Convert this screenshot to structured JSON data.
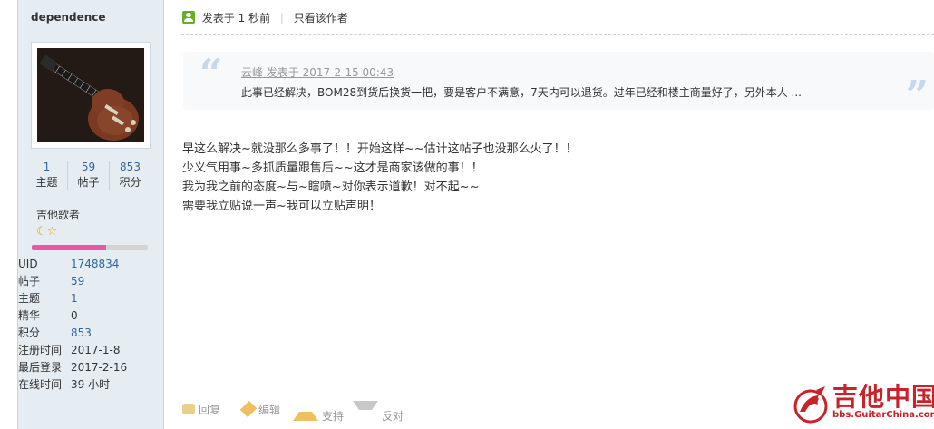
{
  "user": {
    "name": "dependence",
    "stats": [
      {
        "value": "1",
        "label": "主题"
      },
      {
        "value": "59",
        "label": "帖子"
      },
      {
        "value": "853",
        "label": "积分"
      }
    ],
    "group": "吉他歌者",
    "rank_icons": [
      "moon-icon",
      "star-icon"
    ],
    "level_progress": 0.64,
    "level_bar_color": "#e75aa3",
    "info": [
      {
        "key": "UID",
        "value": "1748834"
      },
      {
        "key": "帖子",
        "value": "59"
      },
      {
        "key": "主题",
        "value": "1"
      },
      {
        "key": "精华",
        "value": "0"
      },
      {
        "key": "积分",
        "value": "853"
      },
      {
        "key": "注册时间",
        "value": "2017-1-8"
      },
      {
        "key": "最后登录",
        "value": "2017-2-16"
      },
      {
        "key": "在线时间",
        "value": "39 小时"
      }
    ]
  },
  "post": {
    "posted": "发表于 1 秒前",
    "only_author": "只看该作者",
    "quote": {
      "author_line": "云峰 发表于 2017-2-15 00:43",
      "text": "此事已经解决，BOM28到货后换货一把，要是客户不满意，7天内可以退货。过年已经和楼主商量好了，另外本人 ..."
    },
    "lines": [
      "早这么解决~就没那么多事了！！开始这样~~估计这帖子也没那么火了！！",
      "少义气用事~多抓质量跟售后~~这才是商家该做的事！！",
      "我为我之前的态度~与~瞎喷~对你表示道歉！对不起~~",
      "需要我立贴说一声~我可以立贴声明！"
    ],
    "actions": {
      "reply": "回复",
      "edit": "编辑",
      "support": "支持",
      "oppose": "反对"
    }
  },
  "logo": {
    "text": "吉他中国",
    "url": "bbs.GuitarChina.com"
  },
  "colors": {
    "accent": "#336699",
    "sidebar_bg": "#e5edf2",
    "brand_red": "#c9232a"
  }
}
